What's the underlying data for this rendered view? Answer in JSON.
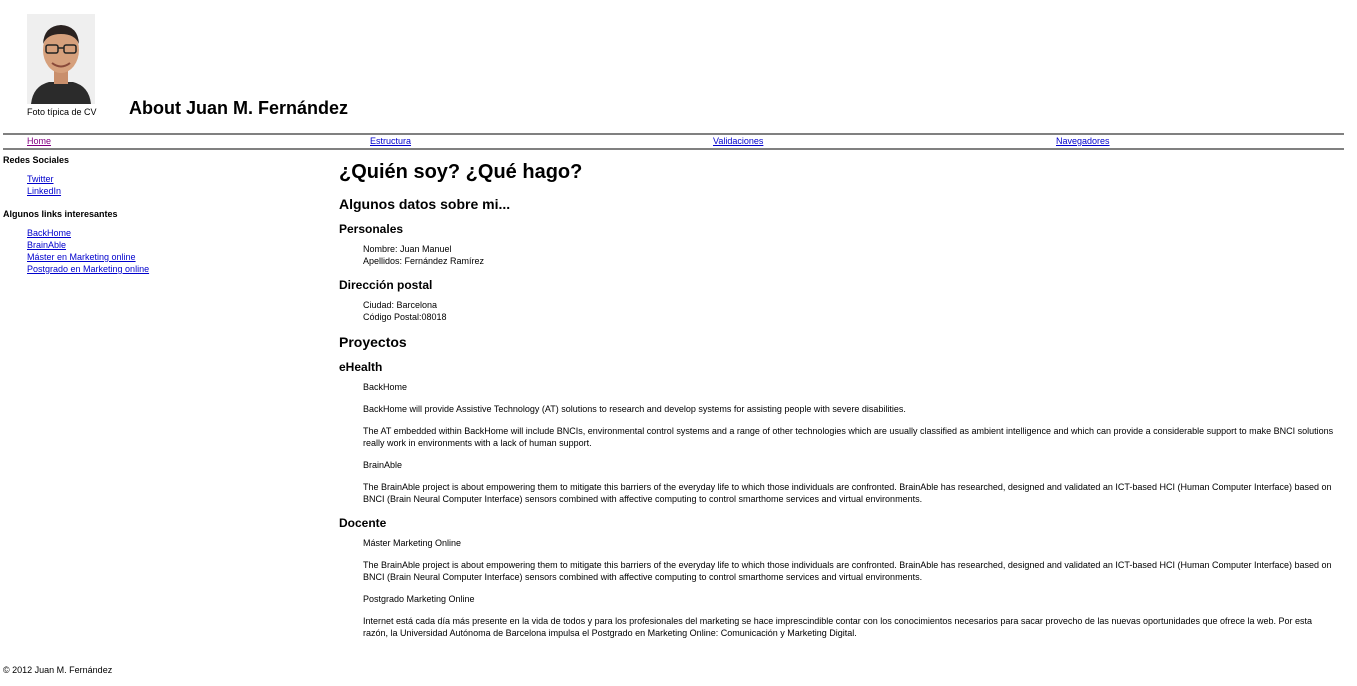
{
  "header": {
    "photo_caption": "Foto típica de CV",
    "title": "About Juan M. Fernández"
  },
  "nav": {
    "items": [
      "Home",
      "Estructura",
      "Validaciones",
      "Navegadores"
    ]
  },
  "sidebar": {
    "social_heading": "Redes Sociales",
    "social_links": [
      "Twitter",
      "LinkedIn"
    ],
    "links_heading": "Algunos links interesantes",
    "links": [
      "BackHome",
      "BrainAble",
      "Máster en Marketing online",
      "Postgrado en Marketing online"
    ]
  },
  "main": {
    "heading": "¿Quién soy? ¿Qué hago?",
    "datos_heading": "Algunos datos sobre mi...",
    "personales_heading": "Personales",
    "nombre": "Nombre: Juan Manuel",
    "apellidos": "Apellidos: Fernández Ramírez",
    "direccion_heading": "Dirección postal",
    "ciudad": "Ciudad: Barcelona",
    "codigo_postal": "Código Postal:08018",
    "proyectos_heading": "Proyectos",
    "ehealth_heading": "eHealth",
    "backhome_title": "BackHome",
    "backhome_p1": "BackHome will provide Assistive Technology (AT) solutions to research and develop systems for assisting people with severe disabilities.",
    "backhome_p2": "The AT embedded within BackHome will include BNCIs, environmental control systems and a range of other technologies which are usually classified as ambient intelligence and which can provide a considerable support to make BNCI solutions really work in environments with a lack of human support.",
    "brainable_title": "BrainAble",
    "brainable_p": "The BrainAble project is about empowering them to mitigate this barriers of the everyday life to which those individuals are confronted. BrainAble has researched, designed and validated an ICT-based HCI (Human Computer Interface) based on BNCI (Brain Neural Computer Interface) sensors combined with affective computing to control smarthome services and virtual environments.",
    "docente_heading": "Docente",
    "master_title": "Máster Marketing Online",
    "master_p": "The BrainAble project is about empowering them to mitigate this barriers of the everyday life to which those individuals are confronted. BrainAble has researched, designed and validated an ICT-based HCI (Human Computer Interface) based on BNCI (Brain Neural Computer Interface) sensors combined with affective computing to control smarthome services and virtual environments.",
    "postgrado_title": "Postgrado Marketing Online",
    "postgrado_p": "Internet está cada día más presente en la vida de todos y para los profesionales del marketing se hace imprescindible contar con los conocimientos necesarios para sacar provecho de las nuevas oportunidades que ofrece la web. Por esta razón, la Universidad Autónoma de Barcelona impulsa el Postgrado en Marketing Online: Comunicación y Marketing Digital."
  },
  "footer": {
    "copyright": "© 2012 Juan M. Fernández"
  }
}
